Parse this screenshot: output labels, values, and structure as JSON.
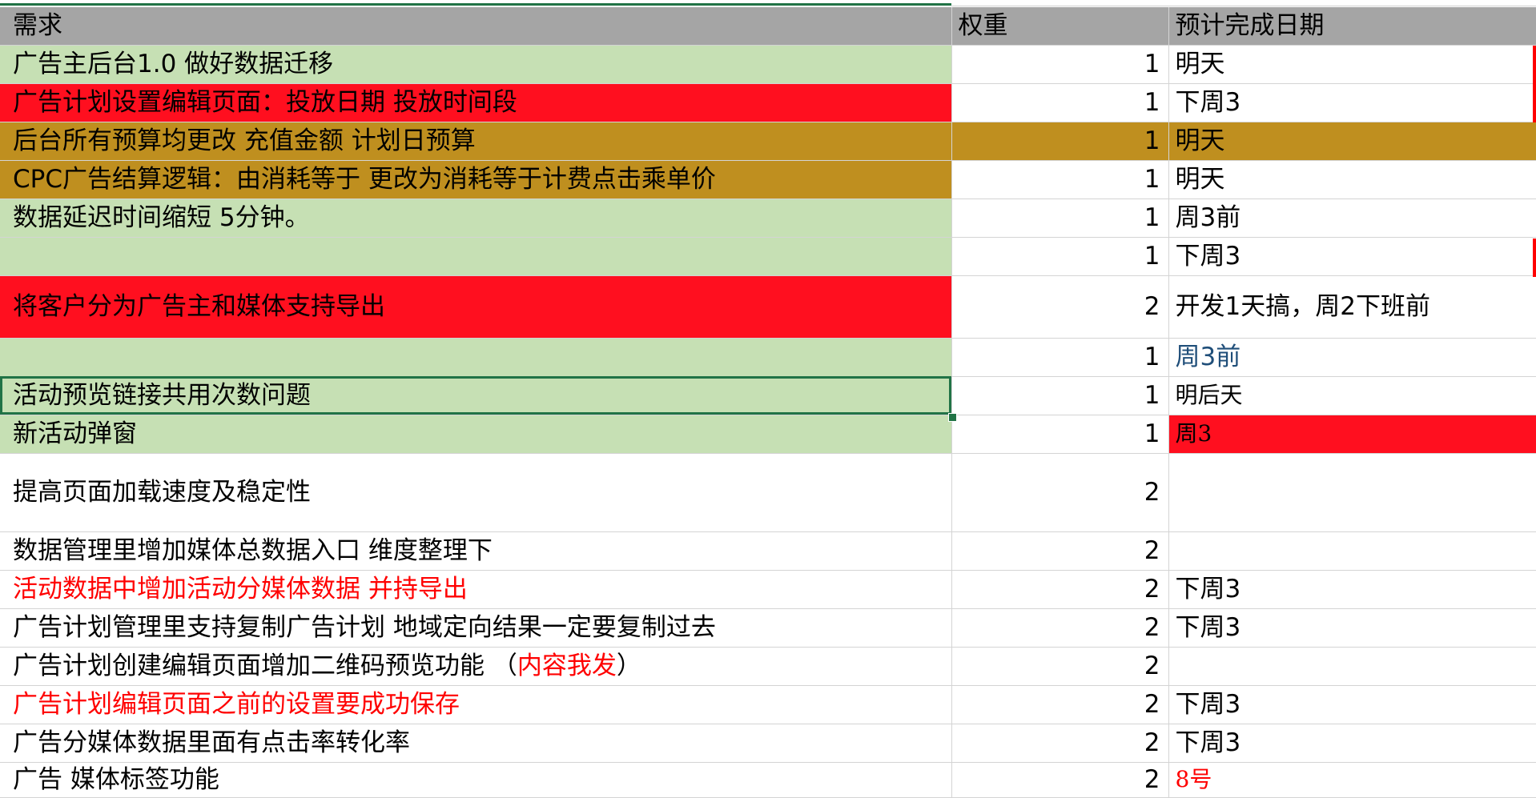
{
  "sheet": {
    "headers": {
      "col1": "需求",
      "col2": "权重",
      "col3": "预计完成日期"
    },
    "rows": [
      {
        "req": "广告主后台1.0 做好数据迁移",
        "weight": "1",
        "date": "明天"
      },
      {
        "req": "广告计划设置编辑页面：投放日期 投放时间段",
        "weight": "1",
        "date": "下周3"
      },
      {
        "req": "后台所有预算均更改 充值金额 计划日预算",
        "weight": "1",
        "date": "明天"
      },
      {
        "req": "CPC广告结算逻辑：由消耗等于  更改为消耗等于计费点击乘单价",
        "weight": "1",
        "date": "明天"
      },
      {
        "req": "数据延迟时间缩短 5分钟。",
        "weight": "1",
        "date": "周3前"
      },
      {
        "req": "",
        "weight": "1",
        "date": "下周3"
      },
      {
        "req": "将客户分为广告主和媒体支持导出",
        "weight": "2",
        "date": "开发1天搞，周2下班前"
      },
      {
        "req": "",
        "weight": "1",
        "date": "周3前"
      },
      {
        "req": "活动预览链接共用次数问题",
        "weight": "1",
        "date": "明后天"
      },
      {
        "req": "新活动弹窗",
        "weight": "1",
        "date": "周3"
      },
      {
        "req": "提高页面加载速度及稳定性",
        "weight": "2",
        "date": ""
      },
      {
        "req": "数据管理里增加媒体总数据入口 维度整理下",
        "weight": "2",
        "date": ""
      },
      {
        "req": "活动数据中增加活动分媒体数据 并持导出",
        "weight": "2",
        "date": "下周3"
      },
      {
        "req": "广告计划管理里支持复制广告计划 地域定向结果一定要复制过去",
        "weight": "2",
        "date": "下周3"
      },
      {
        "req_a": "广告计划创建编辑页面增加二维码预览功能  （",
        "req_b": "内容我发",
        "req_c": "）",
        "weight": "2",
        "date": ""
      },
      {
        "req": "广告计划编辑页面之前的设置要成功保存",
        "weight": "2",
        "date": "下周3"
      },
      {
        "req": "广告分媒体数据里面有点击率转化率",
        "weight": "2",
        "date": "下周3"
      },
      {
        "req": "广告 媒体标签功能",
        "weight": "2",
        "date": "8号"
      }
    ]
  },
  "colors": {
    "green_fill": "#c6e0b4",
    "red_fill": "#ff0f1f",
    "gold_fill": "#bf8f1f",
    "header_fill": "#a5a5a5",
    "selection": "#217346"
  }
}
